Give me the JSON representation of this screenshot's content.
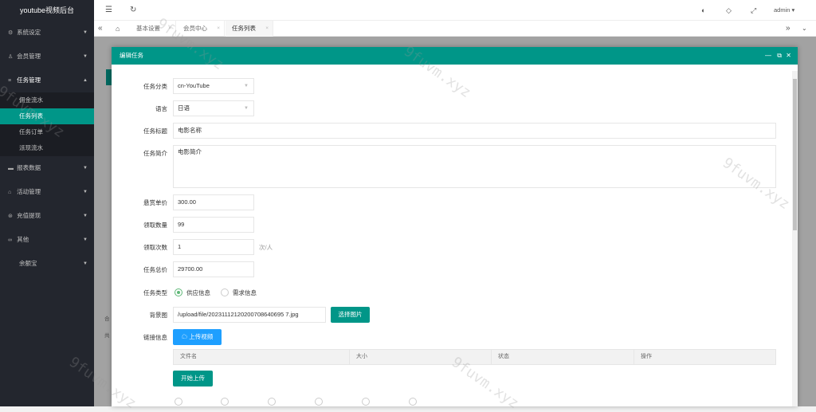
{
  "app": {
    "title": "youtube视频后台"
  },
  "sidebar": {
    "items": [
      {
        "label": "系统设定"
      },
      {
        "label": "会员管理"
      },
      {
        "label": "任务管理"
      },
      {
        "label": "报表数据"
      },
      {
        "label": "活动管理"
      },
      {
        "label": "充值提现"
      },
      {
        "label": "其他"
      },
      {
        "label": "余额宝"
      }
    ],
    "sub": [
      {
        "label": "佣金流水"
      },
      {
        "label": "任务列表"
      },
      {
        "label": "任务订单"
      },
      {
        "label": "派现流水"
      }
    ]
  },
  "topbar": {
    "user": "admin"
  },
  "tabs": [
    {
      "label": "基本设置"
    },
    {
      "label": "会员中心"
    },
    {
      "label": "任务列表"
    }
  ],
  "background": {
    "row1": "合",
    "row2": "共"
  },
  "modal": {
    "title": "编辑任务",
    "labels": {
      "category": "任务分类",
      "language": "语言",
      "title": "任务标题",
      "intro": "任务简介",
      "reward": "悬赏单价",
      "qty": "领取数量",
      "times": "领取次数",
      "total": "任务总价",
      "type": "任务类型",
      "bg": "背景图",
      "link": "链接信息"
    },
    "values": {
      "category": "cn-YouTube",
      "language": "日语",
      "title": "电影名称",
      "intro": "电影简介",
      "reward": "300.00",
      "qty": "99",
      "times": "1",
      "total": "29700.00",
      "bg": "/upload/file/20231112120200708640695 7.jpg"
    },
    "times_suffix": "次/人",
    "type_options": [
      "供应信息",
      "需求信息"
    ],
    "buttons": {
      "select_image": "选择图片",
      "upload_video": "上传视频",
      "start_upload": "开始上传"
    },
    "table_headers": [
      "文件名",
      "大小",
      "状态",
      "操作"
    ]
  },
  "watermark": "9fuvm.xyz"
}
